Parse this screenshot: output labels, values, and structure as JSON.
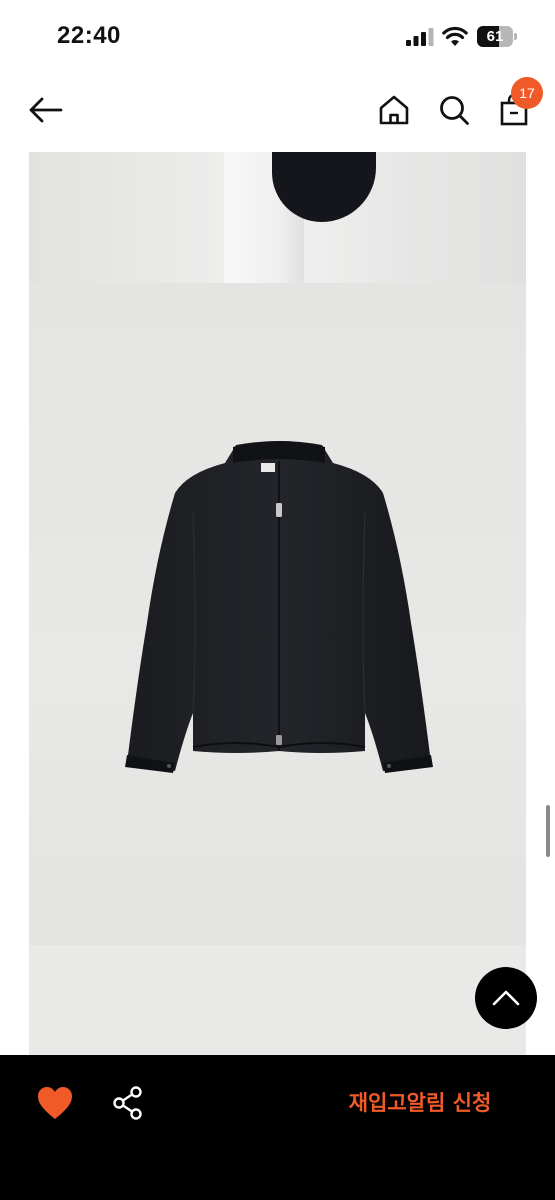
{
  "status_bar": {
    "time": "22:40",
    "battery_level": "61",
    "battery_fraction": 0.61
  },
  "nav": {
    "back_icon": "back-arrow-icon",
    "home_icon": "home-icon",
    "search_icon": "search-icon",
    "cart_icon": "shopping-bag-icon",
    "cart_count": "17"
  },
  "product": {
    "images": [
      "product-photo-detail",
      "product-photo-jacket"
    ]
  },
  "bottom_bar": {
    "like_icon": "heart-icon",
    "share_icon": "share-icon",
    "restock_label": "재입고알림 신청"
  },
  "colors": {
    "accent": "#f05a28",
    "bar_background": "#000000"
  }
}
